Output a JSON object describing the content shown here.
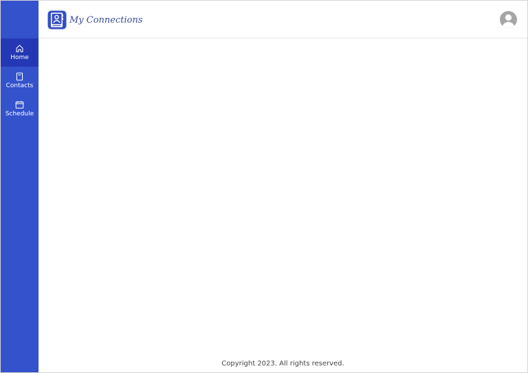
{
  "header": {
    "brand": "My Connections"
  },
  "sidebar": {
    "items": [
      {
        "label": "Home",
        "icon": "home-icon",
        "active": true
      },
      {
        "label": "Contacts",
        "icon": "contacts-book-icon",
        "active": false
      },
      {
        "label": "Schedule",
        "icon": "calendar-icon",
        "active": false
      }
    ]
  },
  "footer": {
    "copyright": "Copyright 2023. All rights reserved."
  },
  "colors": {
    "sidebar": "#3352cc",
    "sidebar_active": "#2437b4",
    "brand_text": "#3a4c9e",
    "avatar": "#a6a6a6"
  }
}
